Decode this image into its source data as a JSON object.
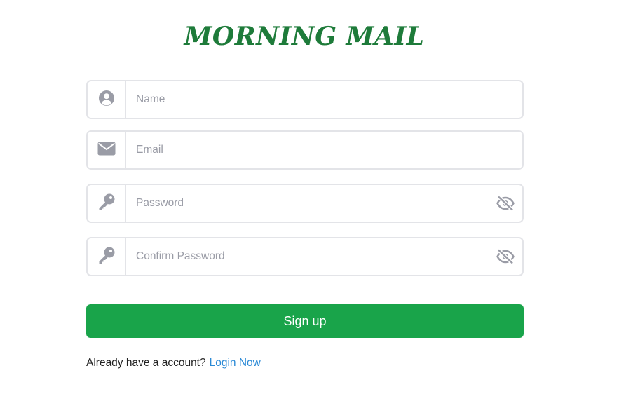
{
  "app": {
    "logo_text": "MORNING MAIL",
    "brand_color": "#1e7b3a"
  },
  "form": {
    "name": {
      "placeholder": "Name",
      "value": "",
      "icon": "user-circle-icon"
    },
    "email": {
      "placeholder": "Email",
      "value": "",
      "icon": "envelope-icon"
    },
    "password": {
      "placeholder": "Password",
      "value": "",
      "icon": "key-icon",
      "toggle_icon": "eye-slash-icon"
    },
    "confirm_password": {
      "placeholder": "Confirm Password",
      "value": "",
      "icon": "key-icon",
      "toggle_icon": "eye-slash-icon"
    },
    "submit_label": "Sign up",
    "submit_color": "#19a44a"
  },
  "footer": {
    "prompt": "Already have a account?",
    "link_label": "Login Now",
    "link_color": "#2b8ad6"
  }
}
